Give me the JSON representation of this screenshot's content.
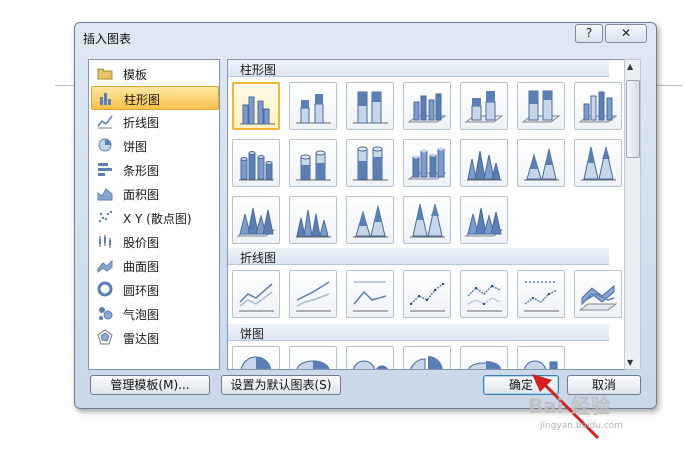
{
  "dialog": {
    "title": "插入图表",
    "help_label": "?",
    "close_label": "✕"
  },
  "categories": [
    {
      "label": "模板",
      "icon": "folder-icon"
    },
    {
      "label": "柱形图",
      "icon": "column-chart-icon",
      "selected": true
    },
    {
      "label": "折线图",
      "icon": "line-chart-icon"
    },
    {
      "label": "饼图",
      "icon": "pie-chart-icon"
    },
    {
      "label": "条形图",
      "icon": "bar-chart-icon"
    },
    {
      "label": "面积图",
      "icon": "area-chart-icon"
    },
    {
      "label": "X Y (散点图)",
      "icon": "scatter-chart-icon"
    },
    {
      "label": "股价图",
      "icon": "stock-chart-icon"
    },
    {
      "label": "曲面图",
      "icon": "surface-chart-icon"
    },
    {
      "label": "圆环图",
      "icon": "doughnut-chart-icon"
    },
    {
      "label": "气泡图",
      "icon": "bubble-chart-icon"
    },
    {
      "label": "雷达图",
      "icon": "radar-chart-icon"
    }
  ],
  "sections": {
    "column": {
      "label": "柱形图"
    },
    "line": {
      "label": "折线图"
    },
    "pie": {
      "label": "饼图"
    }
  },
  "buttons": {
    "manage_templates": "管理模板(M)...",
    "set_default": "设置为默认图表(S)",
    "ok": "确定",
    "cancel": "取消"
  },
  "watermark": {
    "brand": "Bai 经验",
    "url": "jingyan.baidu.com"
  },
  "colors": {
    "accent_selected": "#f7c24c",
    "chart_blue": "#5b7fb5",
    "arrow_red": "#d21f1f"
  }
}
